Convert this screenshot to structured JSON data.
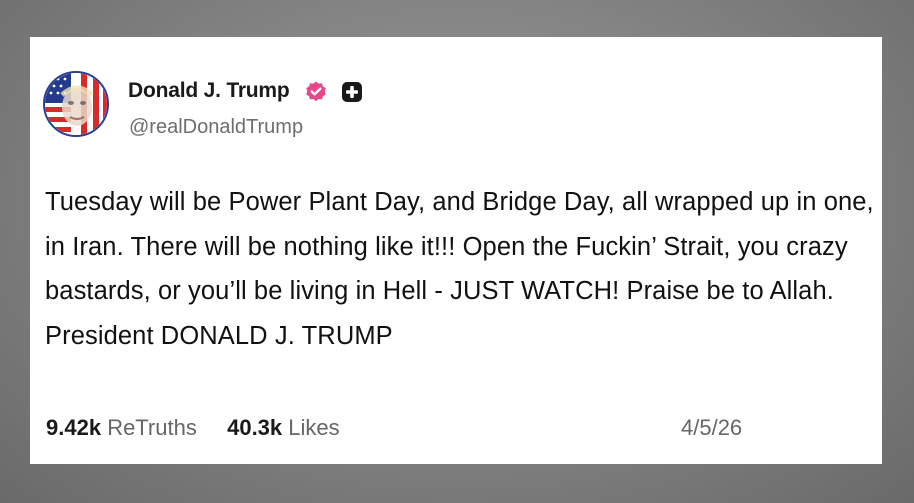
{
  "post": {
    "author": {
      "display_name": "Donald J. Trump",
      "handle": "@realDonaldTrump",
      "verified_icon": "verified-check-badge",
      "plus_icon": "plus-badge"
    },
    "text": "Tuesday will be Power Plant Day, and Bridge Day, all wrapped up in one, in Iran. There will be nothing like it!!! Open the Fuckin’ Strait, you crazy bastards, or you’ll be living in Hell - JUST WATCH! Praise be to Allah. President DONALD J. TRUMP",
    "stats": {
      "retruths_value": "9.42k",
      "retruths_label": "ReTruths",
      "likes_value": "40.3k",
      "likes_label": "Likes"
    },
    "date": "4/5/26"
  },
  "colors": {
    "verified_badge": "#e8478b",
    "plus_badge": "#1a1a1a",
    "name_text": "#1a1a1a",
    "secondary_text": "#666666",
    "card_background": "#ffffff"
  }
}
